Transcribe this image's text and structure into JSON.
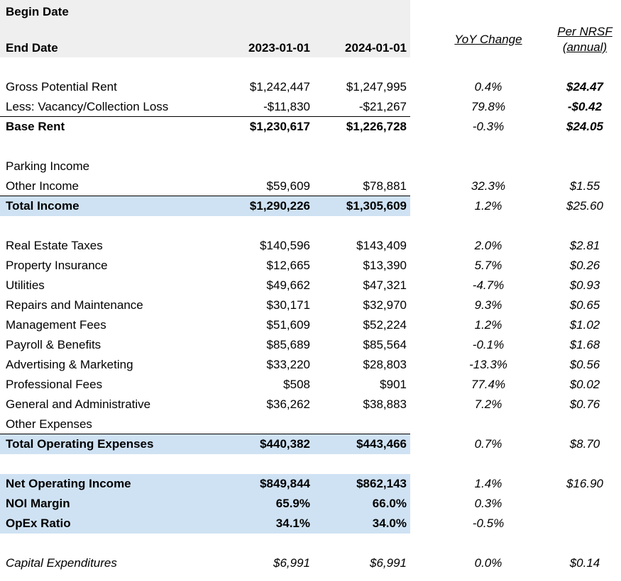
{
  "header": {
    "begin_date_label": "Begin Date",
    "end_date_label": "End Date",
    "col1_date": "2023-01-01",
    "col2_date": "2024-01-01",
    "yoy_label": "YoY Change",
    "per_nrsf_line1": "Per NRSF",
    "per_nrsf_line2": "(annual)"
  },
  "colors": {
    "header_bg": "#efefef",
    "total_band": "#cfe2f3"
  },
  "rows": {
    "gpr": {
      "label": "Gross Potential Rent",
      "v1": "$1,242,447",
      "v2": "$1,247,995",
      "yoy": "0.4%",
      "nrsf": "$24.47"
    },
    "vac": {
      "label": "Less: Vacancy/Collection Loss",
      "v1": "-$11,830",
      "v2": "-$21,267",
      "yoy": "79.8%",
      "nrsf": "-$0.42"
    },
    "base": {
      "label": "Base Rent",
      "v1": "$1,230,617",
      "v2": "$1,226,728",
      "yoy": "-0.3%",
      "nrsf": "$24.05"
    },
    "park": {
      "label": "Parking Income"
    },
    "oth": {
      "label": "Other Income",
      "v1": "$59,609",
      "v2": "$78,881",
      "yoy": "32.3%",
      "nrsf": "$1.55"
    },
    "ti": {
      "label": "Total Income",
      "v1": "$1,290,226",
      "v2": "$1,305,609",
      "yoy": "1.2%",
      "nrsf": "$25.60"
    },
    "ret": {
      "label": "Real Estate Taxes",
      "v1": "$140,596",
      "v2": "$143,409",
      "yoy": "2.0%",
      "nrsf": "$2.81"
    },
    "ins": {
      "label": "Property Insurance",
      "v1": "$12,665",
      "v2": "$13,390",
      "yoy": "5.7%",
      "nrsf": "$0.26"
    },
    "util": {
      "label": "Utilities",
      "v1": "$49,662",
      "v2": "$47,321",
      "yoy": "-4.7%",
      "nrsf": "$0.93"
    },
    "rm": {
      "label": "Repairs and Maintenance",
      "v1": "$30,171",
      "v2": "$32,970",
      "yoy": "9.3%",
      "nrsf": "$0.65"
    },
    "mgmt": {
      "label": "Management Fees",
      "v1": "$51,609",
      "v2": "$52,224",
      "yoy": "1.2%",
      "nrsf": "$1.02"
    },
    "pay": {
      "label": "Payroll & Benefits",
      "v1": "$85,689",
      "v2": "$85,564",
      "yoy": "-0.1%",
      "nrsf": "$1.68"
    },
    "adv": {
      "label": "Advertising & Marketing",
      "v1": "$33,220",
      "v2": "$28,803",
      "yoy": "-13.3%",
      "nrsf": "$0.56"
    },
    "prof": {
      "label": "Professional Fees",
      "v1": "$508",
      "v2": "$901",
      "yoy": "77.4%",
      "nrsf": "$0.02"
    },
    "ga": {
      "label": "General and Administrative",
      "v1": "$36,262",
      "v2": "$38,883",
      "yoy": "7.2%",
      "nrsf": "$0.76"
    },
    "oexp": {
      "label": "Other Expenses"
    },
    "topex": {
      "label": "Total Operating Expenses",
      "v1": "$440,382",
      "v2": "$443,466",
      "yoy": "0.7%",
      "nrsf": "$8.70"
    },
    "noi": {
      "label": "Net Operating Income",
      "v1": "$849,844",
      "v2": "$862,143",
      "yoy": "1.4%",
      "nrsf": "$16.90"
    },
    "noim": {
      "label": "NOI Margin",
      "v1": "65.9%",
      "v2": "66.0%",
      "yoy": "0.3%"
    },
    "opex": {
      "label": "OpEx Ratio",
      "v1": "34.1%",
      "v2": "34.0%",
      "yoy": "-0.5%"
    },
    "capex": {
      "label": "Capital Expenditures",
      "v1": "$6,991",
      "v2": "$6,991",
      "yoy": "0.0%",
      "nrsf": "$0.14"
    }
  }
}
